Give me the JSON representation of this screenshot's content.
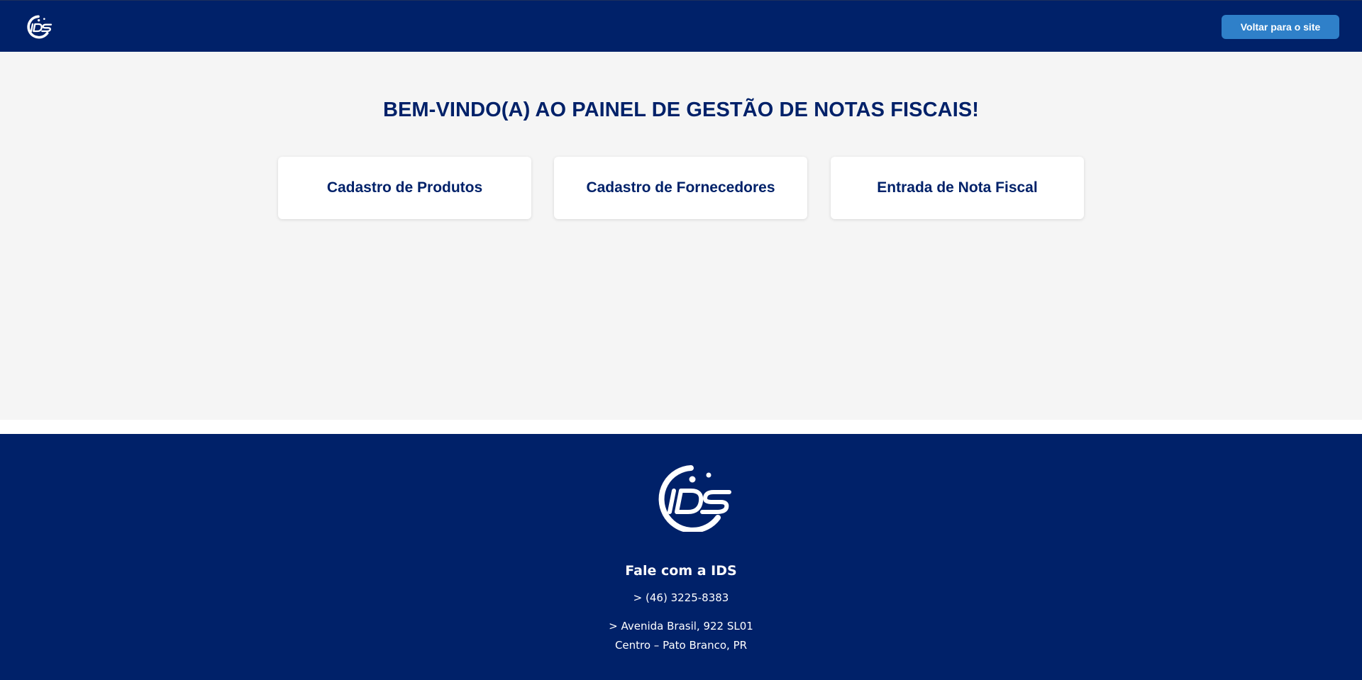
{
  "header": {
    "logo_icon": "ids-logo-icon",
    "back_button_label": "Voltar para o site"
  },
  "main": {
    "title": "BEM-VINDO(A) AO PAINEL DE GESTÃO DE NOTAS FISCAIS!",
    "cards": [
      {
        "label": "Cadastro de Produtos"
      },
      {
        "label": "Cadastro de Fornecedores"
      },
      {
        "label": "Entrada de Nota Fiscal"
      }
    ]
  },
  "footer": {
    "logo_icon": "ids-logo-icon",
    "heading": "Fale com a IDS",
    "phone": "> (46) 3225-8383",
    "address_line1": "> Avenida Brasil, 922 SL01",
    "address_line2": "Centro – Pato Branco, PR"
  },
  "colors": {
    "primary": "#002169",
    "button": "#2f80c9",
    "background": "#f5f5f5",
    "card": "#ffffff"
  }
}
